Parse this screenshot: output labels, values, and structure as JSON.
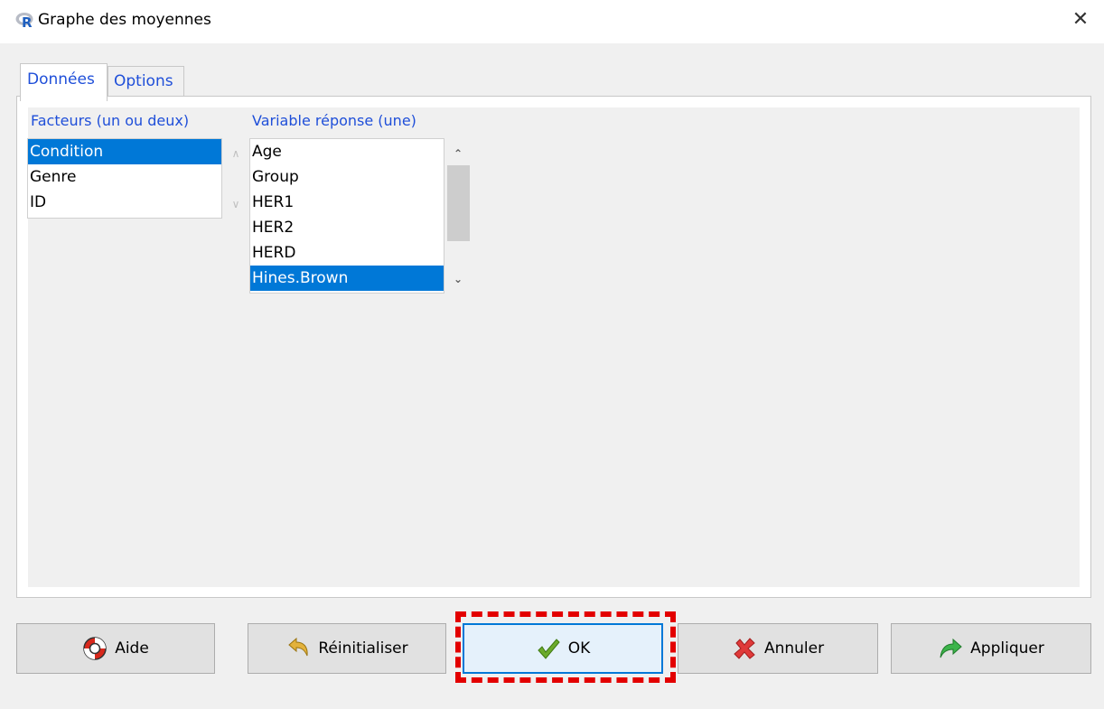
{
  "window": {
    "title": "Graphe des moyennes",
    "close_glyph": "✕"
  },
  "tabs": [
    {
      "label": "Données",
      "active": true
    },
    {
      "label": "Options",
      "active": false
    }
  ],
  "factors": {
    "label": "Facteurs (un ou deux)",
    "items": [
      "Condition",
      "Genre",
      "ID"
    ],
    "selected": "Condition"
  },
  "response": {
    "label": "Variable réponse (une)",
    "items": [
      "Age",
      "Group",
      "HER1",
      "HER2",
      "HERD",
      "Hines.Brown"
    ],
    "selected": "Hines.Brown"
  },
  "buttons": {
    "help": {
      "label": "Aide",
      "icon": "lifebuoy-icon"
    },
    "reset": {
      "label": "Réinitialiser",
      "icon": "undo-arrow-icon"
    },
    "ok": {
      "label": "OK",
      "icon": "checkmark-icon"
    },
    "cancel": {
      "label": "Annuler",
      "icon": "red-x-icon"
    },
    "apply": {
      "label": "Appliquer",
      "icon": "green-arrow-icon"
    }
  },
  "colors": {
    "accent": "#0078d7",
    "label_blue": "#1f4fd9",
    "highlight": "#e30000"
  }
}
